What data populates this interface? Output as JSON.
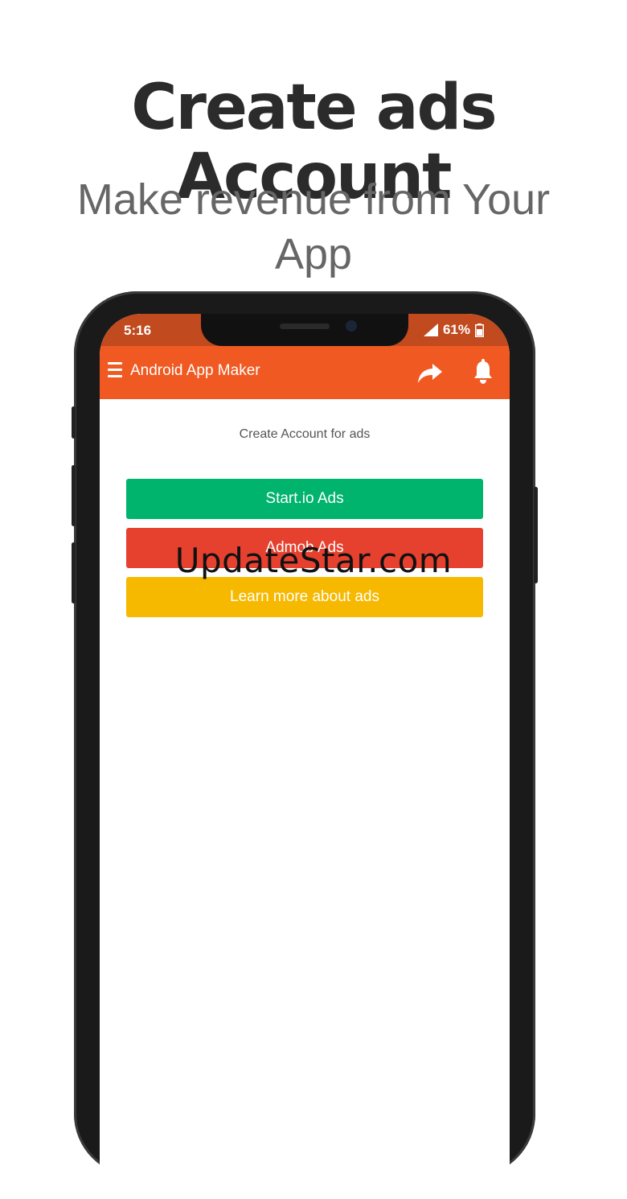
{
  "promo": {
    "headline": "Create ads Account",
    "subheadline": "Make revenue from Your App"
  },
  "status_bar": {
    "time": "5:16",
    "battery": "61%",
    "color": "#c14a1f"
  },
  "app_bar": {
    "title": "Android App Maker",
    "color": "#f05a22",
    "icons": [
      "menu-icon",
      "share-icon",
      "bell-icon"
    ]
  },
  "content": {
    "caption": "Create Account for ads",
    "buttons": [
      {
        "label": "Start.io Ads",
        "color": "#00b46e"
      },
      {
        "label": "Admob Ads",
        "color": "#e6412f"
      },
      {
        "label": "Learn more about ads",
        "color": "#f6b900"
      }
    ]
  },
  "watermark": "UpdateStar.com"
}
